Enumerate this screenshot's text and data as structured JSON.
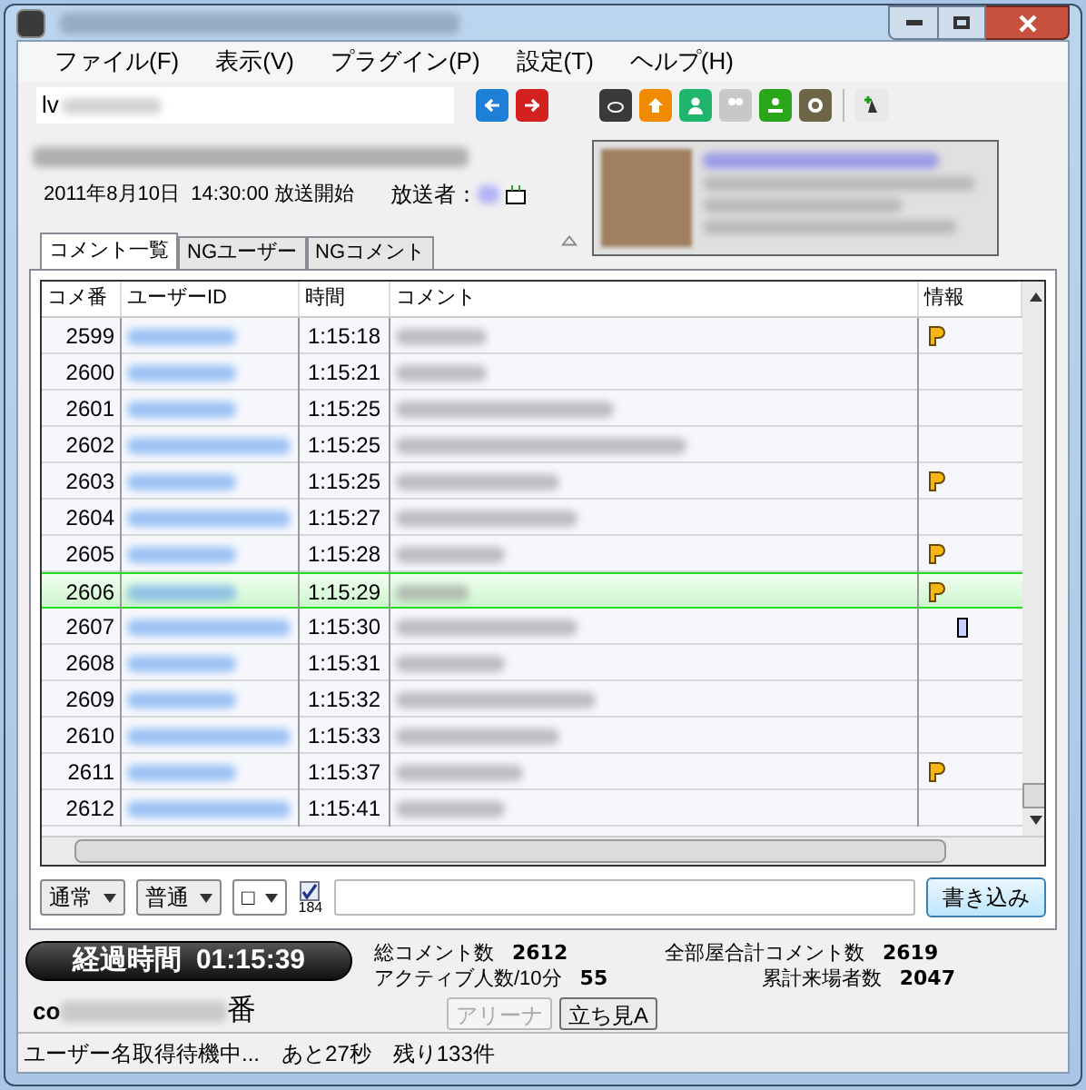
{
  "menu": [
    "ファイル(F)",
    "表示(V)",
    "プラグイン(P)",
    "設定(T)",
    "ヘルプ(H)"
  ],
  "toolbar": {
    "url_prefix": "lv"
  },
  "broadcast": {
    "start": "2011年8月10日  14:30:00 放送開始",
    "caster_label": "放送者："
  },
  "tabs": [
    {
      "label": "コメント一覧",
      "selected": true
    },
    {
      "label": "NGユーザー",
      "selected": false
    },
    {
      "label": "NGコメント",
      "selected": false
    }
  ],
  "table": {
    "columns": [
      "コメ番",
      "ユーザーID",
      "時間",
      "コメント",
      "情報"
    ],
    "rows": [
      {
        "no": "2599",
        "time": "1:15:18",
        "kind": "premium",
        "selected": false
      },
      {
        "no": "2600",
        "time": "1:15:21",
        "kind": "plain",
        "selected": false
      },
      {
        "no": "2601",
        "time": "1:15:25",
        "kind": "plain",
        "selected": false
      },
      {
        "no": "2602",
        "time": "1:15:25",
        "kind": "plain",
        "selected": false
      },
      {
        "no": "2603",
        "time": "1:15:25",
        "kind": "premium",
        "selected": false
      },
      {
        "no": "2604",
        "time": "1:15:27",
        "kind": "plain",
        "selected": false
      },
      {
        "no": "2605",
        "time": "1:15:28",
        "kind": "premium",
        "selected": false
      },
      {
        "no": "2606",
        "time": "1:15:29",
        "kind": "premium",
        "selected": true
      },
      {
        "no": "2607",
        "time": "1:15:30",
        "kind": "mobile",
        "selected": false
      },
      {
        "no": "2608",
        "time": "1:15:31",
        "kind": "plain",
        "selected": false
      },
      {
        "no": "2609",
        "time": "1:15:32",
        "kind": "plain",
        "selected": false
      },
      {
        "no": "2610",
        "time": "1:15:33",
        "kind": "plain",
        "selected": false
      },
      {
        "no": "2611",
        "time": "1:15:37",
        "kind": "premium",
        "selected": false
      },
      {
        "no": "2612",
        "time": "1:15:41",
        "kind": "plain",
        "selected": false
      }
    ]
  },
  "compose": {
    "dropdowns": [
      "通常",
      "普通",
      "□"
    ],
    "anonymous": {
      "label": "184",
      "checked": true
    },
    "submit": "書き込み"
  },
  "elapsed": {
    "label": "経過時間",
    "value": "01:15:39"
  },
  "stats": [
    {
      "label": "総コメント数",
      "value": "2612"
    },
    {
      "label": "アクティブ人数/10分",
      "value": "55"
    },
    {
      "label": "全部屋合計コメント数",
      "value": "2619"
    },
    {
      "label": "累計来場者数",
      "value": "2047"
    }
  ],
  "community": {
    "prefix": "co",
    "suffix": "番"
  },
  "seat_buttons": [
    {
      "label": "アリーナ",
      "disabled": true
    },
    {
      "label": "立ち見A",
      "disabled": false
    }
  ],
  "status_bar": [
    "ユーザー名取得待機中...",
    "あと27秒",
    "残り133件"
  ]
}
